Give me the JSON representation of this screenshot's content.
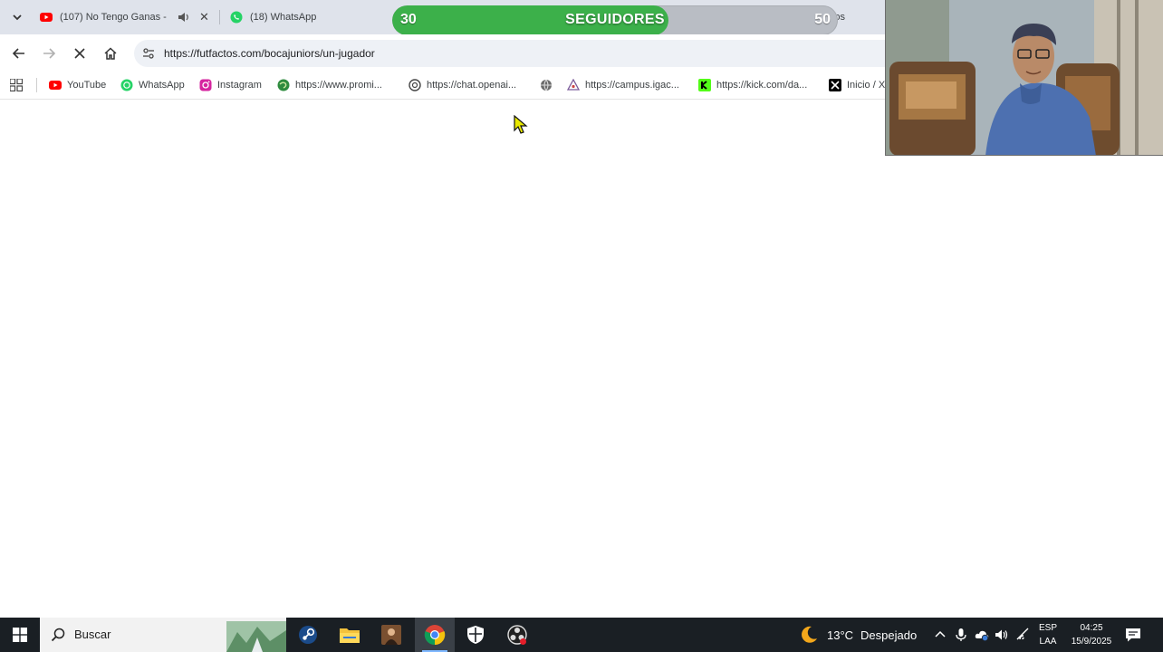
{
  "tabs": [
    {
      "title": "(107) No Tengo Ganas -"
    },
    {
      "title": "(18) WhatsApp"
    },
    {
      "title": "Factos"
    }
  ],
  "goal": {
    "start": "30",
    "label": "SEGUIDORES",
    "end": "50",
    "progress": 0.62,
    "colors": {
      "fill": "#3cb04a",
      "track": "#b9bdc4"
    }
  },
  "toolbar": {
    "url": "https://futfactos.com/bocajuniors/un-jugador"
  },
  "bookmarks": [
    {
      "label": "YouTube",
      "icon": "youtube-icon"
    },
    {
      "label": "WhatsApp",
      "icon": "whatsapp-icon"
    },
    {
      "label": "Instagram",
      "icon": "instagram-icon"
    },
    {
      "label": "https://www.promi...",
      "icon": "globe-green-icon"
    },
    {
      "label": "https://chat.openai...",
      "icon": "openai-icon"
    },
    {
      "label": "",
      "icon": "globe-icon"
    },
    {
      "label": "https://campus.igac...",
      "icon": "campus-icon"
    },
    {
      "label": "https://kick.com/da...",
      "icon": "kick-icon"
    },
    {
      "label": "Inicio / X",
      "icon": "x-icon"
    }
  ],
  "taskbar": {
    "search_placeholder": "Buscar",
    "weather": {
      "temp": "13°C",
      "condition": "Despejado"
    },
    "lang": {
      "line1": "ESP",
      "line2": "LAA"
    },
    "clock": {
      "time": "04:25",
      "date": "15/9/2025"
    }
  }
}
